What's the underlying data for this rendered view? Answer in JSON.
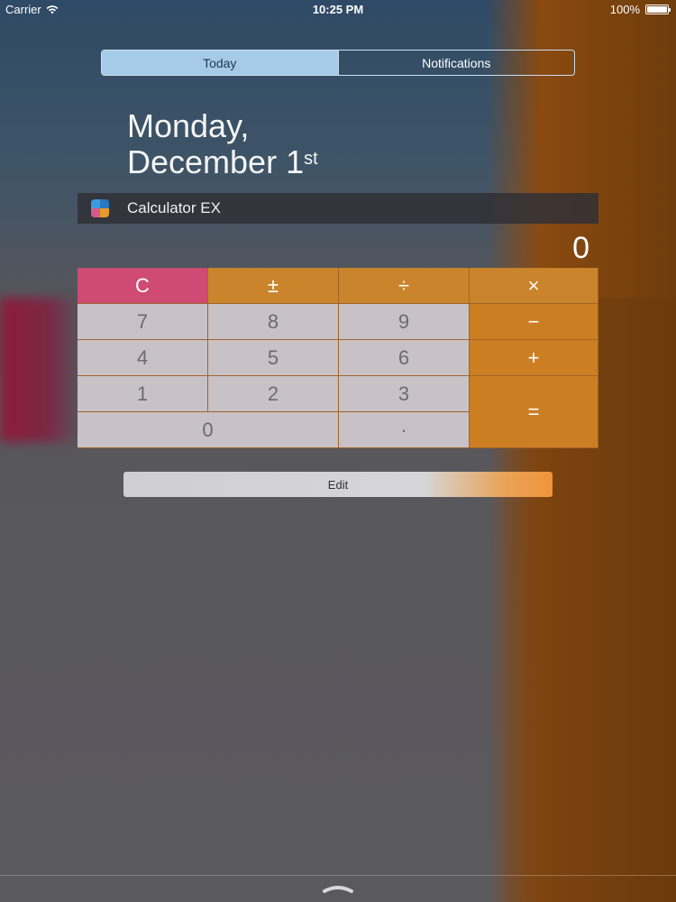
{
  "status_bar": {
    "carrier": "Carrier",
    "time": "10:25 PM",
    "battery": "100%",
    "battery_level": 1.0
  },
  "segments": [
    {
      "label": "Today",
      "selected": true
    },
    {
      "label": "Notifications",
      "selected": false
    }
  ],
  "date": {
    "line1": "Monday,",
    "line2": "December 1",
    "suffix": "st"
  },
  "widget": {
    "title": "Calculator EX",
    "display_value": "0",
    "keys": {
      "clear": "C",
      "plus_minus": "±",
      "divide": "÷",
      "multiply": "×",
      "seven": "7",
      "eight": "8",
      "nine": "9",
      "minus": "−",
      "four": "4",
      "five": "5",
      "six": "6",
      "plus": "+",
      "one": "1",
      "two": "2",
      "three": "3",
      "equals": "=",
      "zero": "0",
      "decimal": "·"
    }
  },
  "edit_button": {
    "label": "Edit"
  },
  "colors": {
    "clear_key": "#cf4b73",
    "operator_key": "#cc7e22",
    "number_key": "#c8c2c6",
    "segment_active": "#a6cbe8"
  }
}
